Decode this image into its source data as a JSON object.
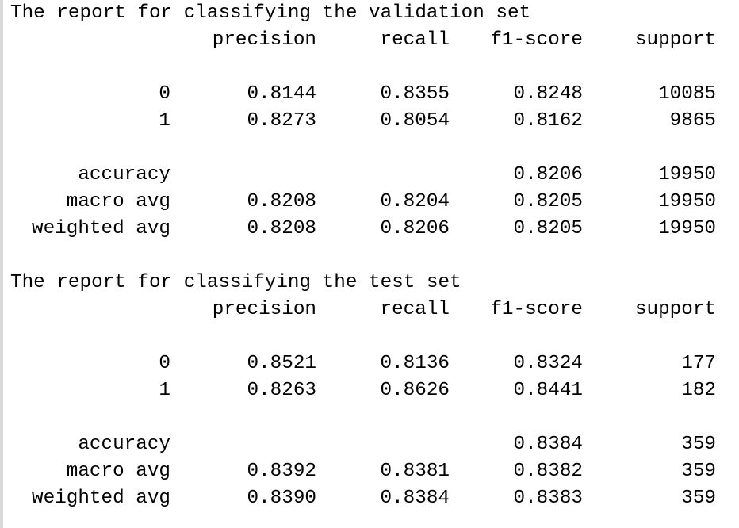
{
  "reports": [
    {
      "heading": "The report for classifying the validation set",
      "columns": [
        "precision",
        "recall",
        "f1-score",
        "support"
      ],
      "class_rows": [
        {
          "label": "0",
          "precision": "0.8144",
          "recall": "0.8355",
          "f1": "0.8248",
          "support": "10085"
        },
        {
          "label": "1",
          "precision": "0.8273",
          "recall": "0.8054",
          "f1": "0.8162",
          "support": "9865"
        }
      ],
      "accuracy": {
        "label": "accuracy",
        "f1": "0.8206",
        "support": "19950"
      },
      "macro": {
        "label": "macro avg",
        "precision": "0.8208",
        "recall": "0.8204",
        "f1": "0.8205",
        "support": "19950"
      },
      "weighted": {
        "label": "weighted avg",
        "precision": "0.8208",
        "recall": "0.8206",
        "f1": "0.8205",
        "support": "19950"
      }
    },
    {
      "heading": "The report for classifying the test set",
      "columns": [
        "precision",
        "recall",
        "f1-score",
        "support"
      ],
      "class_rows": [
        {
          "label": "0",
          "precision": "0.8521",
          "recall": "0.8136",
          "f1": "0.8324",
          "support": "177"
        },
        {
          "label": "1",
          "precision": "0.8263",
          "recall": "0.8626",
          "f1": "0.8441",
          "support": "182"
        }
      ],
      "accuracy": {
        "label": "accuracy",
        "f1": "0.8384",
        "support": "359"
      },
      "macro": {
        "label": "macro avg",
        "precision": "0.8392",
        "recall": "0.8381",
        "f1": "0.8382",
        "support": "359"
      },
      "weighted": {
        "label": "weighted avg",
        "precision": "0.8390",
        "recall": "0.8384",
        "f1": "0.8383",
        "support": "359"
      }
    }
  ]
}
